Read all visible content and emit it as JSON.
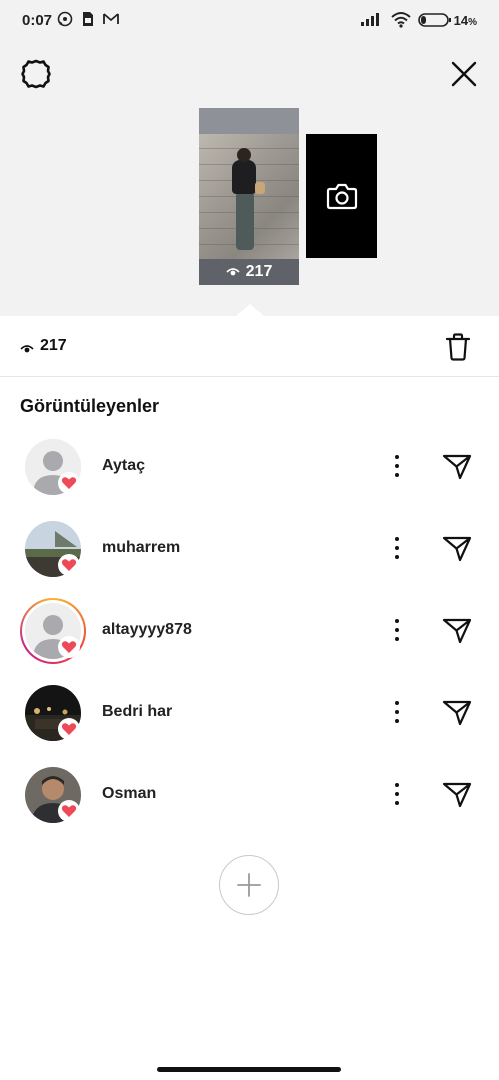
{
  "status_bar": {
    "time": "0:07",
    "battery_percent": "14",
    "battery_unit": "%",
    "icons": [
      "whatsapp-icon",
      "sim-icon",
      "gmail-icon",
      "signal-icon",
      "wifi-icon",
      "battery-icon"
    ]
  },
  "story": {
    "thumbnail_view_count": "217"
  },
  "stats": {
    "view_count": "217"
  },
  "viewers": {
    "title": "Görüntüleyenler",
    "items": [
      {
        "name": "Aytaç",
        "avatar": "default",
        "ring": false
      },
      {
        "name": "muharrem",
        "avatar": "photo-landscape",
        "ring": false
      },
      {
        "name": "altayyyy878",
        "avatar": "default",
        "ring": true
      },
      {
        "name": "Bedri har",
        "avatar": "photo-night",
        "ring": false
      },
      {
        "name": "Osman",
        "avatar": "photo-person",
        "ring": false
      }
    ]
  },
  "colors": {
    "heart": "#ed4956",
    "background_top": "#f2f2f2",
    "ring_gradient": [
      "#f6b62a",
      "#f0433a",
      "#c9218f"
    ]
  }
}
